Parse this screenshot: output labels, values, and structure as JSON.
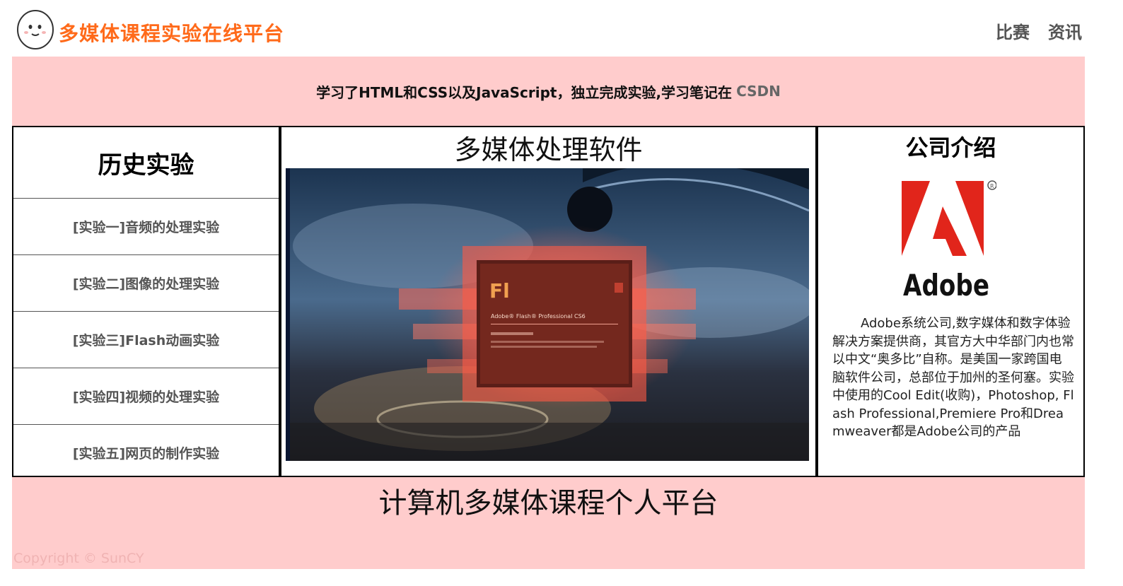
{
  "header": {
    "title": "多媒体课程实验在线平台",
    "nav": [
      "比赛",
      "资讯"
    ]
  },
  "banner": {
    "text": "学习了HTML和CSS以及JavaScript，独立完成实验,学习笔记在",
    "link": "CSDN"
  },
  "left": {
    "heading": "历史实验",
    "items": [
      "[实验一]音频的处理实验",
      "[实验二]图像的处理实验",
      "[实验三]Flash动画实验",
      "[实验四]视频的处理实验",
      "[实验五]网页的制作实验"
    ]
  },
  "center": {
    "heading": "多媒体处理软件",
    "splash_logo": "Fl",
    "splash_product": "Adobe® Flash® Professional CS6"
  },
  "right": {
    "heading": "公司介绍",
    "logo_text": "Adobe",
    "description": "Adobe系统公司,数字媒体和数字体验解决方案提供商，其官方大中华部门内也常以中文“奥多比”自称。是美国一家跨国电脑软件公司，总部位于加州的圣何塞。实验中使用的Cool Edit(收购)，Photoshop, Flash Professional,Premiere Pro和Dreamweaver都是Adobe公司的产品"
  },
  "footer": {
    "title": "计算机多媒体课程个人平台",
    "copyright": "Copyright © SunCY"
  },
  "colors": {
    "accent": "#ff6a1a",
    "pink": "#ffcccc",
    "adobe_red": "#e1251b"
  }
}
